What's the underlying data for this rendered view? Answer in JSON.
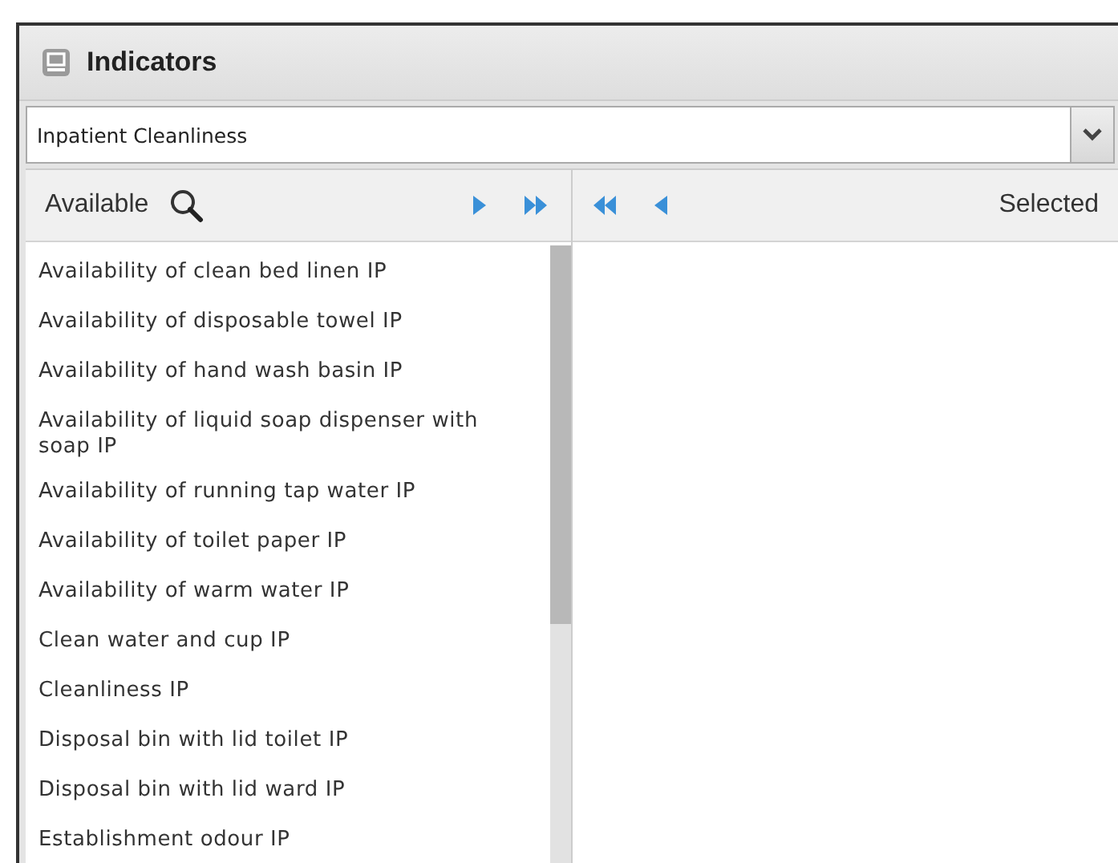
{
  "window": {
    "title": "Indicators"
  },
  "dropdown": {
    "value": "Inpatient Cleanliness"
  },
  "available": {
    "label": "Available",
    "items": [
      "Availability of clean bed linen IP",
      "Availability of disposable towel IP",
      "Availability of hand wash basin IP",
      "Availability of liquid soap dispenser with soap IP",
      "Availability of running tap water IP",
      "Availability of toilet paper IP",
      "Availability of warm water IP",
      "Clean water and cup IP",
      "Cleanliness IP",
      "Disposal bin with lid toilet IP",
      "Disposal bin with lid ward IP",
      "Establishment odour IP"
    ]
  },
  "selected": {
    "label": "Selected"
  }
}
